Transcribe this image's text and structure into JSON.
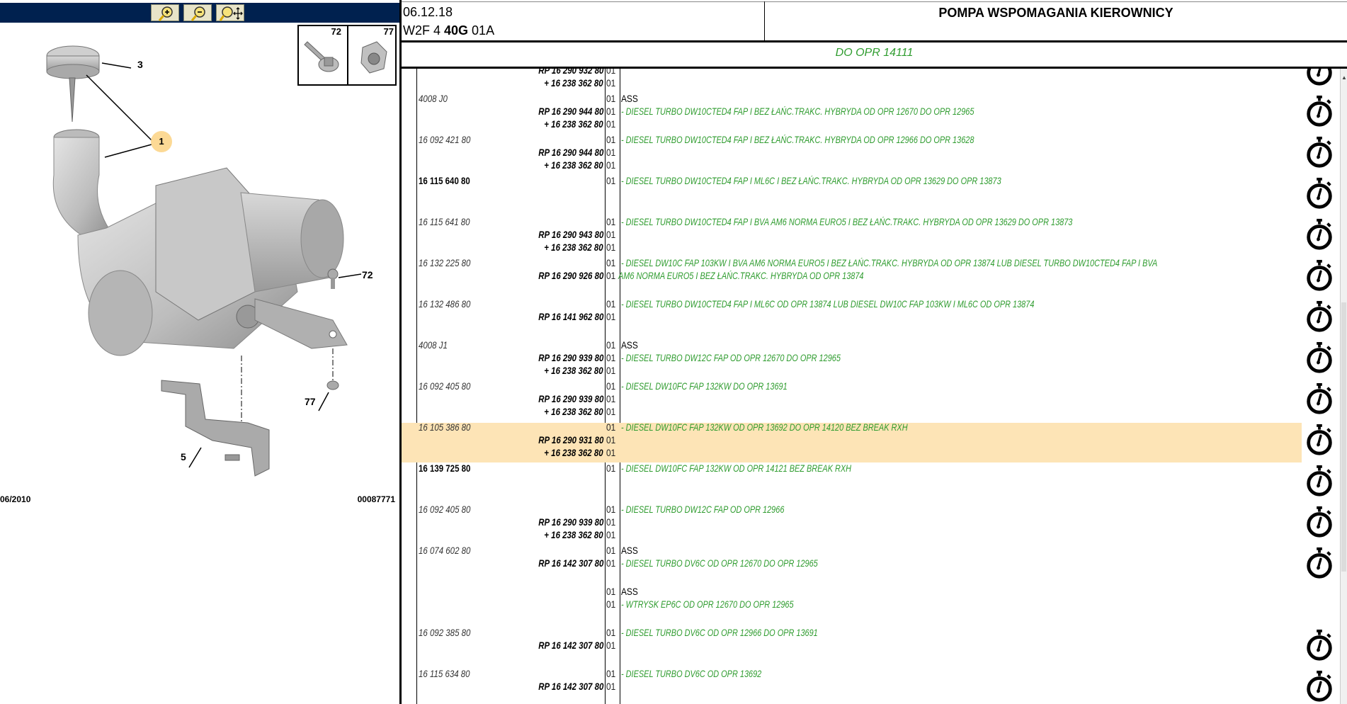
{
  "toolbar": {
    "buttons": [
      {
        "name": "zoom-in-icon"
      },
      {
        "name": "zoom-out-icon"
      },
      {
        "name": "zoom-pan-icon"
      }
    ]
  },
  "diagram": {
    "callouts": {
      "c1": "1",
      "c3": "3",
      "c5": "5",
      "c72": "72",
      "c77": "77"
    },
    "inset": {
      "left": "72",
      "right": "77"
    },
    "date": "06/2010",
    "image_code": "00087771"
  },
  "header": {
    "date": "06.12.18",
    "code_prefix": "W2F 4 ",
    "code_bold": "40G",
    "code_suffix": " 01A",
    "title": "POMPA WSPOMAGANIA KIEROWNICY",
    "filter": "DO OPR 14111"
  },
  "colors": {
    "desc_green": "#2f9c2f",
    "highlight": "#fde4b6",
    "toolbar": "#00214f"
  },
  "groups": [
    {
      "icon": true,
      "lines": [
        {
          "ref": "",
          "type": "sub",
          "qty": "",
          "desc": "",
          "dtype": "green"
        },
        {
          "ref": "RP 16 290 932 80",
          "type": "sub",
          "qty": "01",
          "desc": "",
          "dtype": "green"
        },
        {
          "ref": "+ 16 238 362 80",
          "type": "sub",
          "qty": "01",
          "desc": "",
          "dtype": "green"
        }
      ]
    },
    {
      "icon": true,
      "lines": [
        {
          "ref": "4008 J0",
          "type": "main",
          "qty": "01",
          "desc": "ASS",
          "dtype": "plain"
        },
        {
          "ref": "RP 16 290 944 80",
          "type": "sub",
          "qty": "01",
          "desc": "- DIESEL TURBO DW10CTED4 FAP I BEZ ŁAŃC.TRAKC. HYBRYDA OD OPR 12670 DO OPR 12965",
          "dtype": "green"
        },
        {
          "ref": "+ 16 238 362 80",
          "type": "sub",
          "qty": "01",
          "desc": "",
          "dtype": "green"
        }
      ]
    },
    {
      "icon": true,
      "lines": [
        {
          "ref": "16 092 421 80",
          "type": "main",
          "qty": "01",
          "desc": "- DIESEL TURBO DW10CTED4 FAP I BEZ ŁAŃC.TRAKC. HYBRYDA OD OPR 12966 DO OPR 13628",
          "dtype": "green"
        },
        {
          "ref": "RP 16 290 944 80",
          "type": "sub",
          "qty": "01",
          "desc": "",
          "dtype": "green"
        },
        {
          "ref": "+ 16 238 362 80",
          "type": "sub",
          "qty": "01",
          "desc": "",
          "dtype": "green"
        }
      ]
    },
    {
      "icon": true,
      "lines": [
        {
          "ref": "16 115 640 80",
          "type": "main-bold",
          "qty": "01",
          "desc": "- DIESEL TURBO DW10CTED4 FAP I ML6C I BEZ ŁAŃC.TRAKC. HYBRYDA OD OPR 13629 DO OPR 13873",
          "dtype": "green"
        }
      ]
    },
    {
      "icon": true,
      "lines": [
        {
          "ref": "16 115 641 80",
          "type": "main",
          "qty": "01",
          "desc": "- DIESEL TURBO DW10CTED4 FAP I BVA AM6 NORMA EURO5 I BEZ ŁAŃC.TRAKC. HYBRYDA OD OPR 13629 DO OPR 13873",
          "dtype": "green"
        },
        {
          "ref": "RP 16 290 943 80",
          "type": "sub",
          "qty": "01",
          "desc": "",
          "dtype": "green"
        },
        {
          "ref": "+ 16 238 362 80",
          "type": "sub",
          "qty": "01",
          "desc": "",
          "dtype": "green"
        }
      ]
    },
    {
      "icon": true,
      "lines": [
        {
          "ref": "16 132 225 80",
          "type": "main",
          "qty": "01",
          "desc": "- DIESEL DW10C FAP 103KW I BVA AM6 NORMA EURO5 I BEZ ŁAŃC.TRAKC. HYBRYDA OD OPR 13874 LUB DIESEL TURBO DW10CTED4 FAP I BVA",
          "dtype": "green"
        },
        {
          "ref": "RP 16 290 926 80",
          "type": "sub",
          "qty": "01",
          "desc": "AM6 NORMA EURO5 I BEZ ŁAŃC.TRAKC. HYBRYDA OD OPR 13874",
          "dtype": "green-cont"
        }
      ]
    },
    {
      "icon": true,
      "lines": [
        {
          "ref": "16 132 486 80",
          "type": "main",
          "qty": "01",
          "desc": "- DIESEL TURBO DW10CTED4 FAP I ML6C OD OPR 13874 LUB DIESEL DW10C FAP 103KW I ML6C OD OPR 13874",
          "dtype": "green"
        },
        {
          "ref": "RP 16 141 962 80",
          "type": "sub",
          "qty": "01",
          "desc": "",
          "dtype": "green"
        }
      ]
    },
    {
      "icon": true,
      "lines": [
        {
          "ref": "4008 J1",
          "type": "main",
          "qty": "01",
          "desc": "ASS",
          "dtype": "plain"
        },
        {
          "ref": "RP 16 290 939 80",
          "type": "sub",
          "qty": "01",
          "desc": "- DIESEL TURBO DW12C FAP OD OPR 12670 DO OPR 12965",
          "dtype": "green"
        },
        {
          "ref": "+ 16 238 362 80",
          "type": "sub",
          "qty": "01",
          "desc": "",
          "dtype": "green"
        }
      ]
    },
    {
      "icon": true,
      "lines": [
        {
          "ref": "16 092 405 80",
          "type": "main",
          "qty": "01",
          "desc": "- DIESEL DW10FC FAP 132KW DO OPR 13691",
          "dtype": "green"
        },
        {
          "ref": "RP 16 290 939 80",
          "type": "sub",
          "qty": "01",
          "desc": "",
          "dtype": "green"
        },
        {
          "ref": "+ 16 238 362 80",
          "type": "sub",
          "qty": "01",
          "desc": "",
          "dtype": "green"
        }
      ]
    },
    {
      "icon": true,
      "selected": true,
      "lines": [
        {
          "ref": "16 105 386 80",
          "type": "main",
          "qty": "01",
          "desc": "- DIESEL DW10FC FAP 132KW OD OPR 13692 DO OPR 14120 BEZ BREAK RXH",
          "dtype": "green"
        },
        {
          "ref": "RP 16 290 931 80",
          "type": "sub",
          "qty": "01",
          "desc": "",
          "dtype": "green"
        },
        {
          "ref": "+ 16 238 362 80",
          "type": "sub",
          "qty": "01",
          "desc": "",
          "dtype": "green"
        }
      ]
    },
    {
      "icon": true,
      "lines": [
        {
          "ref": "16 139 725 80",
          "type": "main-bold",
          "qty": "01",
          "desc": "- DIESEL DW10FC FAP 132KW OD OPR 14121 BEZ BREAK RXH",
          "dtype": "green"
        }
      ]
    },
    {
      "icon": true,
      "lines": [
        {
          "ref": "16 092 405 80",
          "type": "main",
          "qty": "01",
          "desc": "- DIESEL TURBO DW12C FAP OD OPR 12966",
          "dtype": "green"
        },
        {
          "ref": "RP 16 290 939 80",
          "type": "sub",
          "qty": "01",
          "desc": "",
          "dtype": "green"
        },
        {
          "ref": "+ 16 238 362 80",
          "type": "sub",
          "qty": "01",
          "desc": "",
          "dtype": "green"
        }
      ]
    },
    {
      "icon": true,
      "lines": [
        {
          "ref": "16 074 602 80",
          "type": "main",
          "qty": "01",
          "desc": "ASS",
          "dtype": "plain"
        },
        {
          "ref": "RP 16 142 307 80",
          "type": "sub",
          "qty": "01",
          "desc": "- DIESEL TURBO DV6C OD OPR 12670 DO OPR 12965",
          "dtype": "green"
        }
      ]
    },
    {
      "icon": false,
      "lines": [
        {
          "ref": "",
          "type": "main",
          "qty": "01",
          "desc": "ASS",
          "dtype": "plain"
        },
        {
          "ref": "",
          "type": "sub",
          "qty": "01",
          "desc": "- WTRYSK EP6C OD OPR 12670 DO OPR 12965",
          "dtype": "green"
        }
      ]
    },
    {
      "icon": true,
      "lines": [
        {
          "ref": "16 092 385 80",
          "type": "main",
          "qty": "01",
          "desc": "- DIESEL TURBO DV6C OD OPR 12966 DO OPR 13691",
          "dtype": "green"
        },
        {
          "ref": "RP 16 142 307 80",
          "type": "sub",
          "qty": "01",
          "desc": "",
          "dtype": "green"
        }
      ]
    },
    {
      "icon": true,
      "lines": [
        {
          "ref": "16 115 634 80",
          "type": "main",
          "qty": "01",
          "desc": "- DIESEL TURBO DV6C OD OPR 13692",
          "dtype": "green"
        },
        {
          "ref": "RP 16 142 307 80",
          "type": "sub",
          "qty": "01",
          "desc": "",
          "dtype": "green"
        }
      ]
    }
  ]
}
